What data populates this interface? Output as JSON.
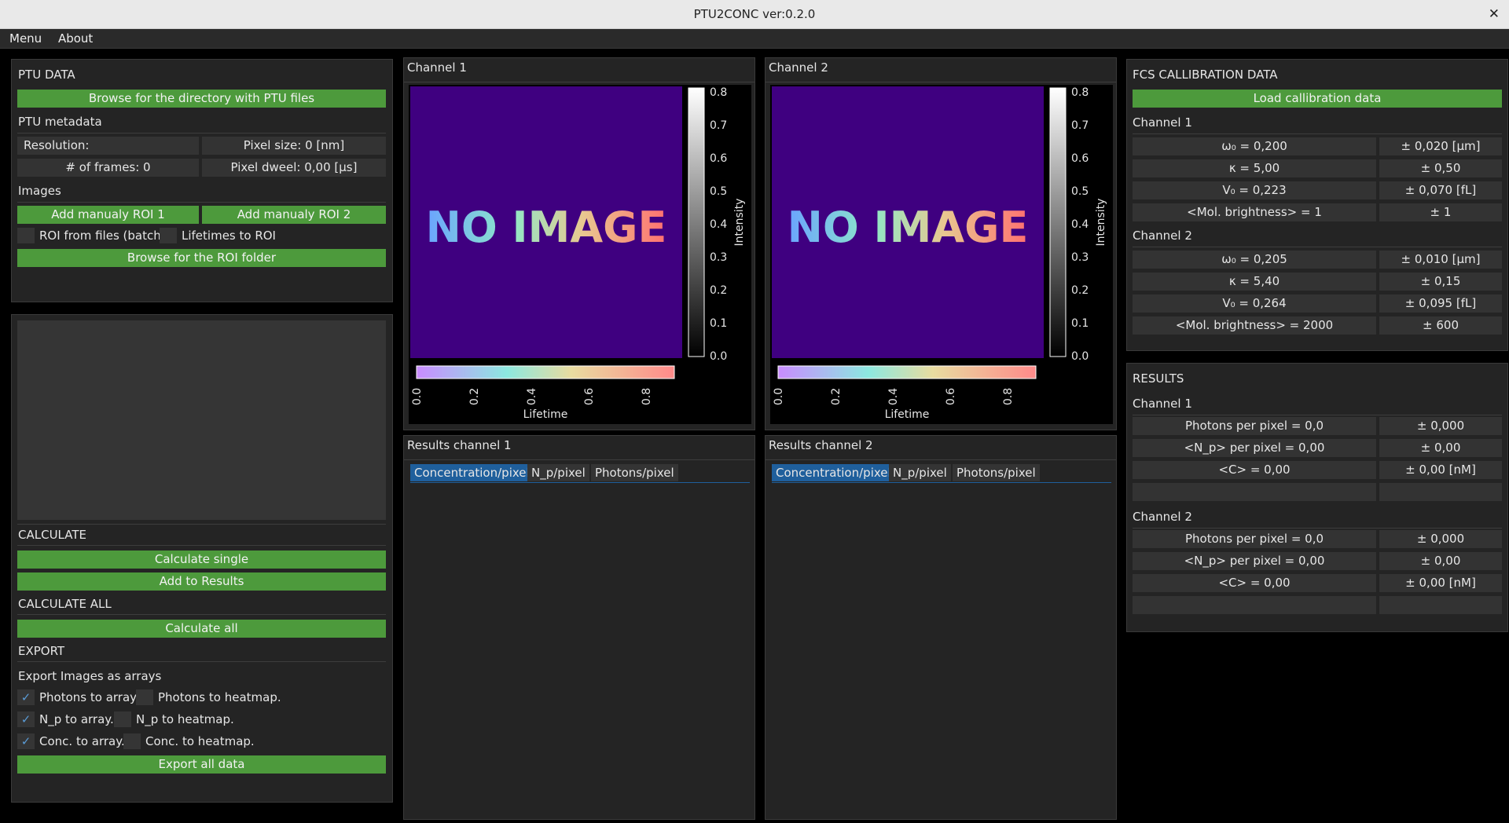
{
  "window": {
    "title": "PTU2CONC  ver:0.2.0",
    "close_glyph": "✕"
  },
  "menubar": {
    "items": [
      "Menu",
      "About"
    ]
  },
  "ptu": {
    "header": "PTU DATA",
    "browse_button": "Browse for the directory with PTU files",
    "metadata_label": "PTU metadata",
    "resolution": "Resolution:",
    "pixel_size": "Pixel size: 0 [nm]",
    "frames": "# of frames: 0",
    "pixel_dwell": "Pixel dweel: 0,00 [µs]",
    "images_label": "Images",
    "roi1_button": "Add manualy ROI 1",
    "roi2_button": "Add manualy ROI 2",
    "roi_batch_label": "ROI from files (batch)",
    "roi_batch_checked": false,
    "lifetimes_roi_label": "Lifetimes to ROI",
    "lifetimes_roi_checked": false,
    "roi_folder_button": "Browse for the ROI folder"
  },
  "calc": {
    "header": "CALCULATE",
    "single_button": "Calculate single",
    "add_results_button": "Add to Results",
    "all_header": "CALCULATE ALL",
    "all_button": "Calculate all"
  },
  "export": {
    "header": "EXPORT",
    "sub_label": "Export Images as arrays",
    "options": [
      {
        "array_label": "Photons to array.",
        "array_checked": true,
        "heat_label": "Photons to heatmap.",
        "heat_checked": false
      },
      {
        "array_label": "N_p to array.",
        "array_checked": true,
        "heat_label": "N_p to heatmap.",
        "heat_checked": false
      },
      {
        "array_label": "Conc. to array.",
        "array_checked": true,
        "heat_label": "Conc. to heatmap.",
        "heat_checked": false
      }
    ],
    "export_button": "Export all data",
    "check_glyph": "✓"
  },
  "channels": [
    {
      "title": "Channel 1",
      "image_text": "NO IMAGE",
      "intensity_label": "Intensity",
      "intensity_ticks": [
        "0.8",
        "0.7",
        "0.6",
        "0.5",
        "0.4",
        "0.3",
        "0.2",
        "0.1",
        "0.0"
      ],
      "lifetime_label": "Lifetime",
      "lifetime_ticks": [
        "0.0",
        "0.2",
        "0.4",
        "0.6",
        "0.8"
      ],
      "results_title": "Results channel 1",
      "tabs": [
        "Concentration/pixel",
        "N_p/pixel",
        "Photons/pixel"
      ],
      "active_tab": 0
    },
    {
      "title": "Channel 2",
      "image_text": "NO IMAGE",
      "intensity_label": "Intensity",
      "intensity_ticks": [
        "0.8",
        "0.7",
        "0.6",
        "0.5",
        "0.4",
        "0.3",
        "0.2",
        "0.1",
        "0.0"
      ],
      "lifetime_label": "Lifetime",
      "lifetime_ticks": [
        "0.0",
        "0.2",
        "0.4",
        "0.6",
        "0.8"
      ],
      "results_title": "Results channel 2",
      "tabs": [
        "Concentration/pixel",
        "N_p/pixel",
        "Photons/pixel"
      ],
      "active_tab": 0
    }
  ],
  "fcs": {
    "header": "FCS CALLIBRATION DATA",
    "load_button": "Load callibration data",
    "channels": [
      {
        "label": "Channel 1",
        "rows": [
          [
            "ω₀ = 0,200",
            "± 0,020 [µm]"
          ],
          [
            "κ = 5,00",
            "± 0,50"
          ],
          [
            "V₀ = 0,223",
            "± 0,070 [fL]"
          ],
          [
            "<Mol. brightness> = 1",
            "± 1"
          ]
        ]
      },
      {
        "label": "Channel 2",
        "rows": [
          [
            "ω₀ = 0,205",
            "± 0,010 [µm]"
          ],
          [
            "κ = 5,40",
            "± 0,15"
          ],
          [
            "V₀ = 0,264",
            "± 0,095 [fL]"
          ],
          [
            "<Mol. brightness> = 2000",
            "± 600"
          ]
        ]
      }
    ]
  },
  "results": {
    "header": "RESULTS",
    "channels": [
      {
        "label": "Channel 1",
        "rows": [
          [
            "Photons per pixel = 0,0",
            "± 0,000"
          ],
          [
            "<N_p> per pixel = 0,00",
            "± 0,00"
          ],
          [
            "<C> = 0,00",
            "± 0,00 [nM]"
          ],
          [
            "",
            ""
          ]
        ]
      },
      {
        "label": "Channel 2",
        "rows": [
          [
            "Photons per pixel = 0,0",
            "± 0,000"
          ],
          [
            "<N_p> per pixel = 0,00",
            "± 0,00"
          ],
          [
            "<C> = 0,00",
            "± 0,00 [nM]"
          ],
          [
            "",
            ""
          ]
        ]
      }
    ]
  },
  "colors": {
    "accent_green": "#4d9a3c",
    "tab_active": "#1f5f9c",
    "image_bg": "#3f0080"
  }
}
